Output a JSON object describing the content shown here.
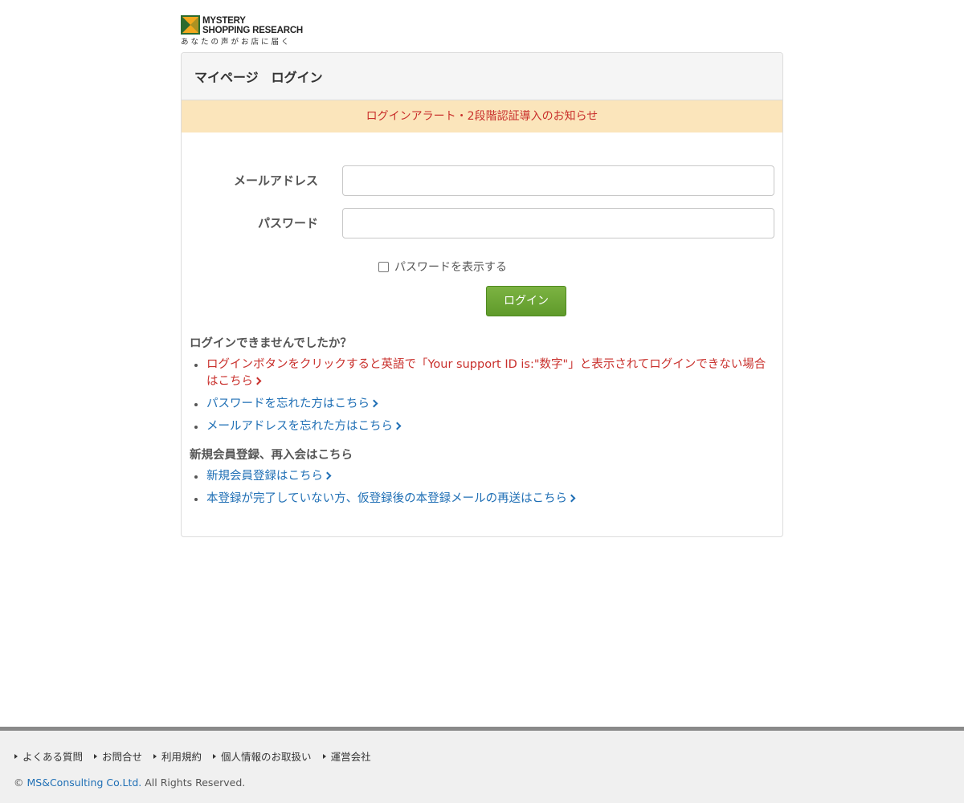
{
  "logo": {
    "line1": "MYSTERY",
    "line2": "SHOPPING RESEARCH",
    "tagline": "あなたの声がお店に届く"
  },
  "panel": {
    "title": "マイページ　ログイン",
    "alert": "ログインアラート・2段階認証導入のお知らせ"
  },
  "form": {
    "email_label": "メールアドレス",
    "email_value": "",
    "password_label": "パスワード",
    "password_value": "",
    "show_password_label": "パスワードを表示する",
    "login_button": "ログイン"
  },
  "help": {
    "title": "ログインできませんでしたか？",
    "items": [
      "ログインボタンをクリックすると英語で「Your support ID is:\"数字\"」と表示されてログインできない場合はこちら",
      "パスワードを忘れた方はこちら",
      "メールアドレスを忘れた方はこちら"
    ]
  },
  "register": {
    "title": "新規会員登録、再入会はこちら",
    "items": [
      "新規会員登録はこちら",
      "本登録が完了していない方、仮登録後の本登録メールの再送はこちら"
    ]
  },
  "footer": {
    "links": [
      "よくある質問",
      "お問合せ",
      "利用規約",
      "個人情報のお取扱い",
      "運営会社"
    ],
    "copyright_prefix": "© ",
    "company": "MS&Consulting Co.Ltd.",
    "copyright_suffix": " All Rights Reserved."
  },
  "colors": {
    "alert_bg": "#fbe5bb",
    "alert_text": "#c9302c",
    "link": "#1f6fb5",
    "button": "#6ba536"
  },
  "icons": {
    "logo": "mystery-shopping-logo-icon",
    "chevron": "chevron-right-icon",
    "footer_bullet": "triangle-right-icon",
    "checkbox": "checkbox-icon"
  }
}
